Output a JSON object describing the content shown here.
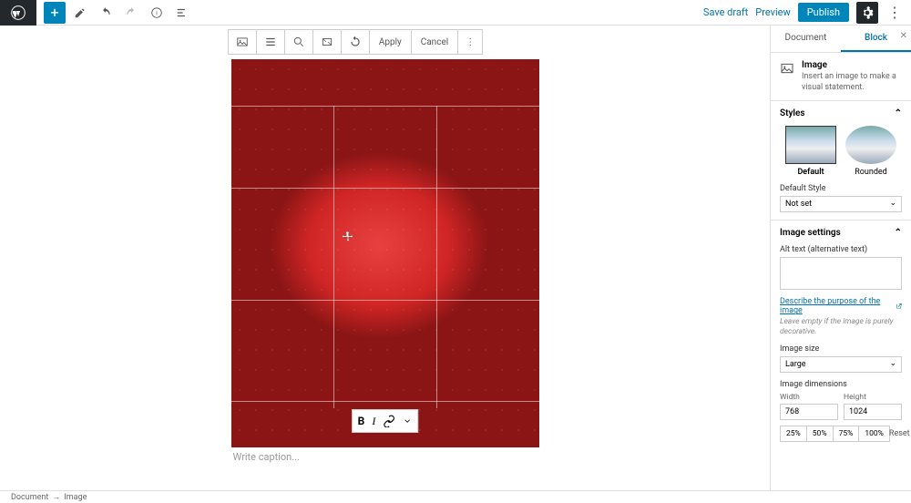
{
  "toolbar": {
    "save_draft": "Save draft",
    "preview": "Preview",
    "publish": "Publish"
  },
  "block_toolbar": {
    "apply": "Apply",
    "cancel": "Cancel"
  },
  "caption_placeholder": "Write caption...",
  "sidebar": {
    "tab_document": "Document",
    "tab_block": "Block",
    "block_info": {
      "title": "Image",
      "description": "Insert an image to make a visual statement."
    },
    "styles": {
      "header": "Styles",
      "default": "Default",
      "rounded": "Rounded",
      "default_style_label": "Default Style",
      "default_style_value": "Not set"
    },
    "image_settings": {
      "header": "Image settings",
      "alt_label": "Alt text (alternative text)",
      "alt_value": "",
      "describe_link": "Describe the purpose of the image",
      "hint": "Leave empty if the image is purely decorative.",
      "size_label": "Image size",
      "size_value": "Large",
      "dims_label": "Image dimensions",
      "width_label": "Width",
      "height_label": "Height",
      "width": "768",
      "height": "1024",
      "pct": [
        "25%",
        "50%",
        "75%",
        "100%"
      ],
      "reset": "Reset"
    }
  },
  "breadcrumb": {
    "document": "Document",
    "image": "Image"
  }
}
